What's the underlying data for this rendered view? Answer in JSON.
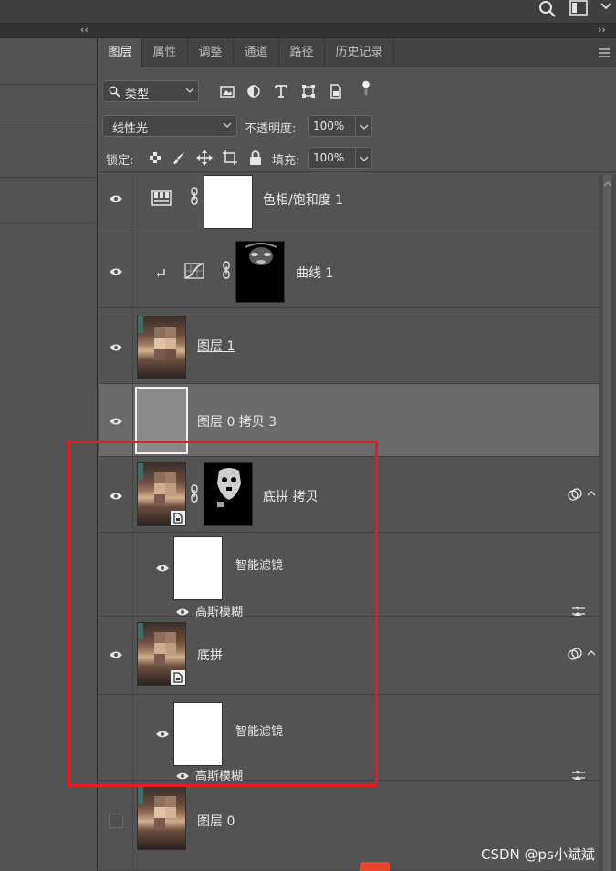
{
  "tabs": [
    {
      "label": "图层",
      "active": true
    },
    {
      "label": "属性",
      "active": false
    },
    {
      "label": "调整",
      "active": false
    },
    {
      "label": "通道",
      "active": false
    },
    {
      "label": "路径",
      "active": false
    },
    {
      "label": "历史记录",
      "active": false
    }
  ],
  "filter": {
    "kind_label": "类型"
  },
  "blend": {
    "mode": "线性光",
    "opacity_label": "不透明度:",
    "opacity_value": "100%",
    "lock_label": "锁定:",
    "fill_label": "填充:",
    "fill_value": "100%"
  },
  "layers": [
    {
      "name": "色相/饱和度 1",
      "type": "adjustment"
    },
    {
      "name": "曲线 1",
      "type": "adjustment-clipped"
    },
    {
      "name": "图层 1",
      "type": "pixel"
    },
    {
      "name": "图层 0 拷贝 3",
      "type": "pixel",
      "selected": true
    },
    {
      "name": "底拼 拷贝",
      "type": "smart-object",
      "filter_group": "智能滤镜",
      "filter": "高斯模糊"
    },
    {
      "name": "底拼",
      "type": "smart-object",
      "filter_group": "智能滤镜",
      "filter": "高斯模糊"
    },
    {
      "name": "图层 0",
      "type": "pixel",
      "visible": false
    }
  ],
  "collapse": {
    "left": "‹‹",
    "right": "››"
  },
  "watermark": "CSDN @ps小斌斌",
  "colors": {
    "highlight_box": "#e02020",
    "panel_bg": "#535353"
  }
}
